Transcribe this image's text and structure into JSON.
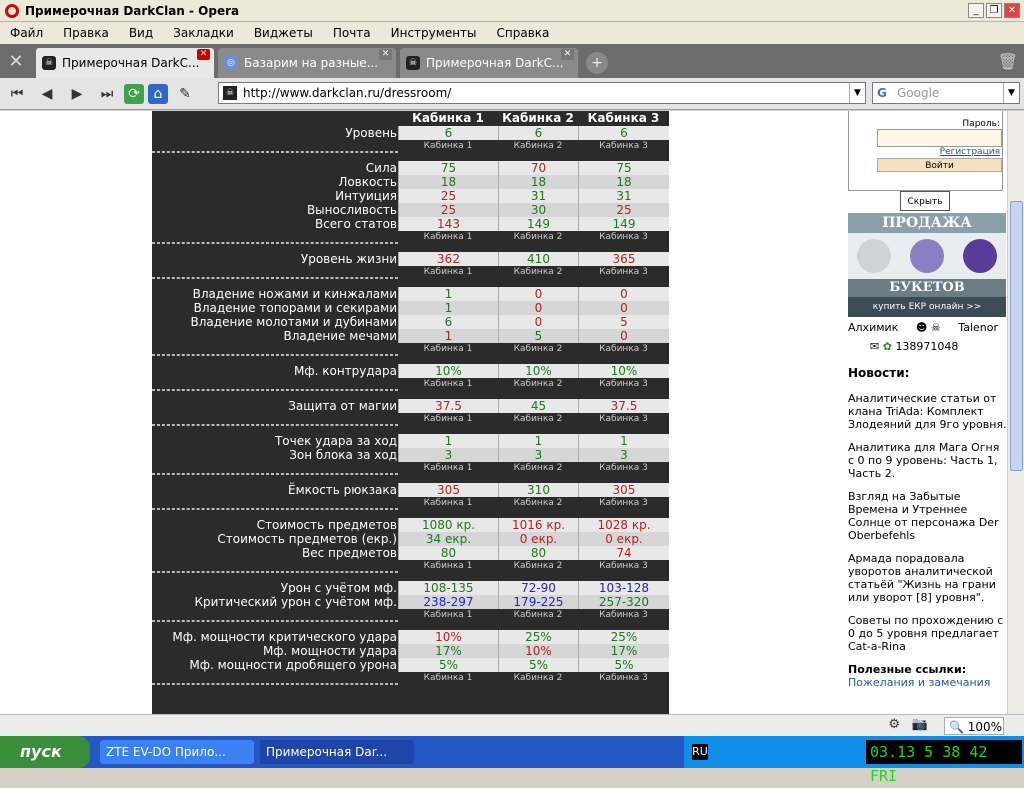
{
  "window": {
    "title": "Примерочная DarkClan - Opera"
  },
  "menu": [
    "Файл",
    "Правка",
    "Вид",
    "Закладки",
    "Виджеты",
    "Почта",
    "Инструменты",
    "Справка"
  ],
  "tabs": [
    {
      "label": "Примерочная DarkC...",
      "active": true
    },
    {
      "label": "Базарим на разные...",
      "active": false
    },
    {
      "label": "Примерочная DarkC...",
      "active": false
    }
  ],
  "address": {
    "url": "http://www.darkclan.ru/dressroom/"
  },
  "search": {
    "placeholder": "Google"
  },
  "table": {
    "headers": [
      "",
      "Кабинка 1",
      "Кабинка 2",
      "Кабинка 3"
    ],
    "sub": [
      "Кабинка 1",
      "Кабинка 2",
      "Кабинка 3"
    ],
    "groups": [
      {
        "rows": [
          {
            "label": "Уровень",
            "v": [
              "6",
              "6",
              "6"
            ],
            "c": [
              "g",
              "g",
              "g"
            ]
          }
        ]
      },
      {
        "rows": [
          {
            "label": "Сила",
            "v": [
              "75",
              "70",
              "75"
            ],
            "c": [
              "g",
              "r",
              "g"
            ]
          },
          {
            "label": "Ловкость",
            "v": [
              "18",
              "18",
              "18"
            ],
            "c": [
              "g",
              "g",
              "g"
            ]
          },
          {
            "label": "Интуиция",
            "v": [
              "25",
              "31",
              "31"
            ],
            "c": [
              "r",
              "g",
              "g"
            ]
          },
          {
            "label": "Выносливость",
            "v": [
              "25",
              "30",
              "25"
            ],
            "c": [
              "r",
              "g",
              "r"
            ]
          },
          {
            "label": "Всего статов",
            "v": [
              "143",
              "149",
              "149"
            ],
            "c": [
              "r",
              "g",
              "g"
            ]
          }
        ]
      },
      {
        "rows": [
          {
            "label": "Уровень жизни",
            "v": [
              "362",
              "410",
              "365"
            ],
            "c": [
              "r",
              "g",
              "r"
            ]
          }
        ]
      },
      {
        "rows": [
          {
            "label": "Владение ножами и кинжалами",
            "v": [
              "1",
              "0",
              "0"
            ],
            "c": [
              "g",
              "r",
              "r"
            ]
          },
          {
            "label": "Владение топорами и секирами",
            "v": [
              "1",
              "0",
              "0"
            ],
            "c": [
              "g",
              "r",
              "r"
            ]
          },
          {
            "label": "Владение молотами и дубинами",
            "v": [
              "6",
              "0",
              "5"
            ],
            "c": [
              "g",
              "r",
              "r"
            ]
          },
          {
            "label": "Владение мечами",
            "v": [
              "1",
              "5",
              "0"
            ],
            "c": [
              "r",
              "g",
              "r"
            ]
          }
        ]
      },
      {
        "rows": [
          {
            "label": "Мф. контрудара",
            "v": [
              "10%",
              "10%",
              "10%"
            ],
            "c": [
              "g",
              "g",
              "g"
            ]
          }
        ]
      },
      {
        "rows": [
          {
            "label": "Защита от магии",
            "v": [
              "37.5",
              "45",
              "37.5"
            ],
            "c": [
              "r",
              "g",
              "r"
            ]
          }
        ]
      },
      {
        "rows": [
          {
            "label": "Точек удара за ход",
            "v": [
              "1",
              "1",
              "1"
            ],
            "c": [
              "g",
              "g",
              "g"
            ]
          },
          {
            "label": "Зон блока за ход",
            "v": [
              "3",
              "3",
              "3"
            ],
            "c": [
              "g",
              "g",
              "g"
            ]
          }
        ]
      },
      {
        "rows": [
          {
            "label": "Ёмкость рюкзака",
            "v": [
              "305",
              "310",
              "305"
            ],
            "c": [
              "r",
              "g",
              "r"
            ]
          }
        ]
      },
      {
        "rows": [
          {
            "label": "Стоимость предметов",
            "v": [
              "1080 кр.",
              "1016 кр.",
              "1028 кр."
            ],
            "c": [
              "g",
              "r",
              "r"
            ]
          },
          {
            "label": "Стоимость предметов (екр.)",
            "v": [
              "34 екр.",
              "0 екр.",
              "0 екр."
            ],
            "c": [
              "g",
              "r",
              "r"
            ]
          },
          {
            "label": "Вес предметов",
            "v": [
              "80",
              "80",
              "74"
            ],
            "c": [
              "g",
              "g",
              "r"
            ]
          }
        ]
      },
      {
        "rows": [
          {
            "label": "Урон с учётом мф.",
            "v": [
              "108-135",
              "72-90",
              "103-128"
            ],
            "c": [
              "g",
              "b",
              "b"
            ]
          },
          {
            "label": "Критический урон с учётом мф.",
            "v": [
              "238-297",
              "179-225",
              "257-320"
            ],
            "c": [
              "b",
              "b",
              "g"
            ]
          }
        ]
      },
      {
        "rows": [
          {
            "label": "Мф. мощности критического удара",
            "v": [
              "10%",
              "25%",
              "25%"
            ],
            "c": [
              "r",
              "g",
              "g"
            ]
          },
          {
            "label": "Мф. мощности удара",
            "v": [
              "17%",
              "10%",
              "17%"
            ],
            "c": [
              "g",
              "r",
              "g"
            ]
          },
          {
            "label": "Мф. мощности дробящего урона",
            "v": [
              "5%",
              "5%",
              "5%"
            ],
            "c": [
              "g",
              "g",
              "g"
            ]
          }
        ]
      }
    ]
  },
  "sidebar": {
    "login": {
      "password_label": "Пароль:",
      "register": "Регистрация",
      "enter": "Войти"
    },
    "hide": "Скрыть",
    "promo": {
      "top": "ПРОДАЖА",
      "bottom": "БУКЕТОВ",
      "buy": "купить ЕКР онлайн  >>"
    },
    "chars": {
      "left": "Алхимик",
      "right": "Talenor",
      "icq": "138971048"
    },
    "news_title": "Новости:",
    "news": [
      "Аналитические статьи от клана TriAda: Комплект Злодеяний для 9го уровня.",
      "Аналитика для Мага Огня с 0 по 9 уровень: Часть 1, Часть 2.",
      "Взгляд на Забытые Времена и Утреннее Солнце от персонажа Der Oberbefehls",
      "Армада порадовала уворотов аналитической статьёй \"Жизнь на грани или уворот [8] уровня\".",
      "Советы по прохождению с 0 до 5 уровня предлагает Cat-a-Rina"
    ],
    "links_title": "Полезные ссылки:",
    "links_first": "Пожелания и замечания"
  },
  "status": {
    "zoom": "100%"
  },
  "taskbar": {
    "start": "пуск",
    "items": [
      "ZTE EV-DO Прило...",
      "Примерочная Dar..."
    ],
    "lang": "RU",
    "clock": "03.13  5 38 42 FRI"
  }
}
